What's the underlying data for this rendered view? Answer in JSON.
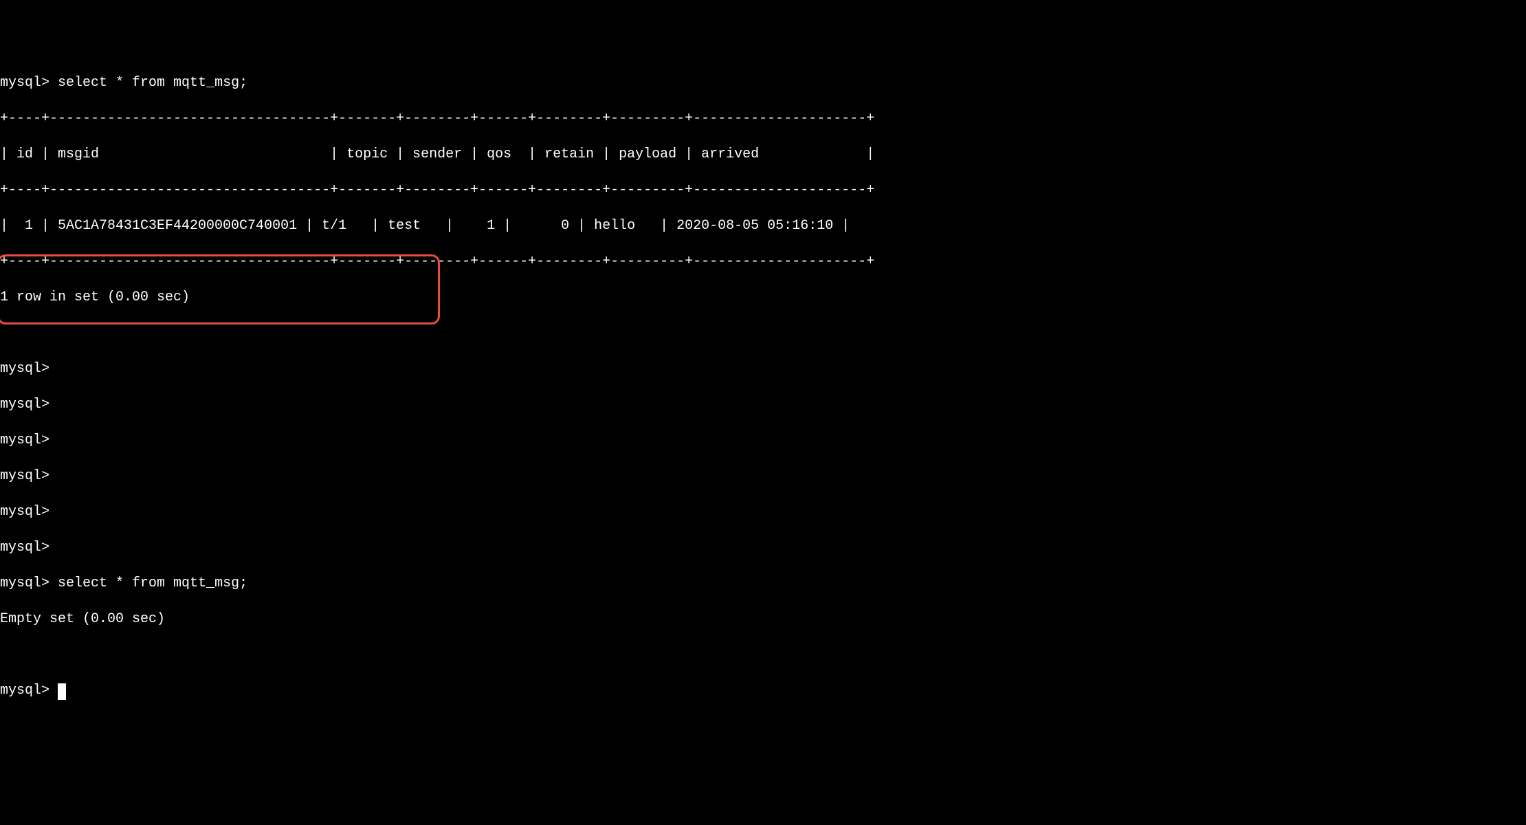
{
  "terminal": {
    "prompt": "mysql>",
    "query1": "select * from mqtt_msg;",
    "table": {
      "border_top": "+----+----------------------------------+-------+--------+------+--------+---------+---------------------+",
      "header_row": "| id | msgid                            | topic | sender | qos  | retain | payload | arrived             |",
      "border_mid": "+----+----------------------------------+-------+--------+------+--------+---------+---------------------+",
      "data_row": "|  1 | 5AC1A78431C3EF44200000C740001 | t/1   | test   |    1 |      0 | hello   | 2020-08-05 05:16:10 |",
      "border_bot": "+----+----------------------------------+-------+--------+------+--------+---------+---------------------+"
    },
    "result1": "1 row in set (0.00 sec)",
    "query2": "select * from mqtt_msg;",
    "result2": "Empty set (0.00 sec)"
  },
  "chart_data": {
    "type": "table",
    "title": "mqtt_msg",
    "columns": [
      "id",
      "msgid",
      "topic",
      "sender",
      "qos",
      "retain",
      "payload",
      "arrived"
    ],
    "rows": [
      {
        "id": 1,
        "msgid": "5AC1A78431C3EF44200000C740001",
        "topic": "t/1",
        "sender": "test",
        "qos": 1,
        "retain": 0,
        "payload": "hello",
        "arrived": "2020-08-05 05:16:10"
      }
    ]
  }
}
